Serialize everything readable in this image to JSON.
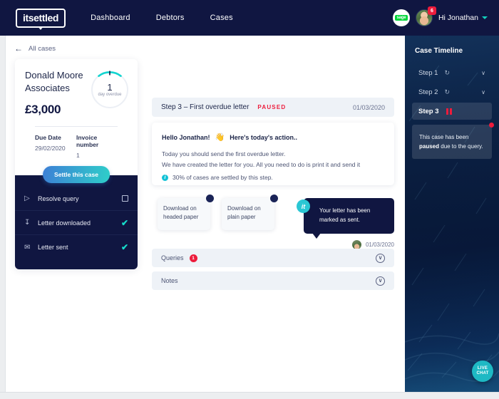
{
  "nav": {
    "logo": "itsettled",
    "links": [
      {
        "label": "Dashboard"
      },
      {
        "label": "Debtors"
      },
      {
        "label": "Cases"
      }
    ],
    "sage_label": "sage",
    "notification_count": "6",
    "greeting": "Hi Jonathan"
  },
  "back": {
    "label": "All cases",
    "arrow": "←"
  },
  "case": {
    "name": "Donald Moore Associates",
    "amount": "£3,000",
    "gauge": {
      "value": "1",
      "label": "day overdue"
    },
    "due_date_label": "Due Date",
    "due_date_value": "29/02/2020",
    "invoice_label": "Invoice number",
    "invoice_value": "1",
    "settle_label": "Settle this case",
    "checklist": [
      {
        "icon": "▷",
        "label": "Resolve query",
        "state": "unchecked"
      },
      {
        "icon": "↧",
        "label": "Letter downloaded",
        "state": "checked",
        "tick": "✔"
      },
      {
        "icon": "✉",
        "label": "Letter sent",
        "state": "checked",
        "tick": "✔"
      }
    ]
  },
  "step": {
    "title": "Step 3 – First overdue letter",
    "status": "PAUSED",
    "date": "01/03/2020"
  },
  "action": {
    "hello": "Hello Jonathan!",
    "wave": "👋",
    "headline": "Here's today's action..",
    "line1": "Today you should send the first overdue letter.",
    "line2": "We have created the letter for you. All you need to do is print it and send it",
    "info_icon": "i",
    "info_text": "30% of cases are settled by this step."
  },
  "downloads": [
    {
      "label": "Download on headed paper"
    },
    {
      "label": "Download on plain paper"
    }
  ],
  "bubble": {
    "avatar_initials": "it",
    "message": "Your letter has been marked as sent.",
    "date": "01/03/2020"
  },
  "collapsibles": [
    {
      "label": "Queries",
      "badge": "1",
      "chevron": "∨"
    },
    {
      "label": "Notes",
      "badge": "",
      "chevron": "∨"
    }
  ],
  "timeline": {
    "title": "Case Timeline",
    "steps": [
      {
        "label": "Step 1",
        "icon": "↻",
        "chevron": "∨",
        "active": false
      },
      {
        "label": "Step 2",
        "icon": "↻",
        "chevron": "∨",
        "active": false
      },
      {
        "label": "Step 3",
        "icon": "",
        "chevron": "",
        "active": true
      }
    ],
    "tooltip_prefix": "This case has been ",
    "tooltip_bold": "paused",
    "tooltip_suffix": " due to the query."
  },
  "live_chat": {
    "line1": "LIVE",
    "line2": "CHAT"
  },
  "colors": {
    "navy": "#101641",
    "accent_teal": "#16dccb",
    "danger_red": "#ed1c3c",
    "panel_bg": "#eef2f7"
  }
}
